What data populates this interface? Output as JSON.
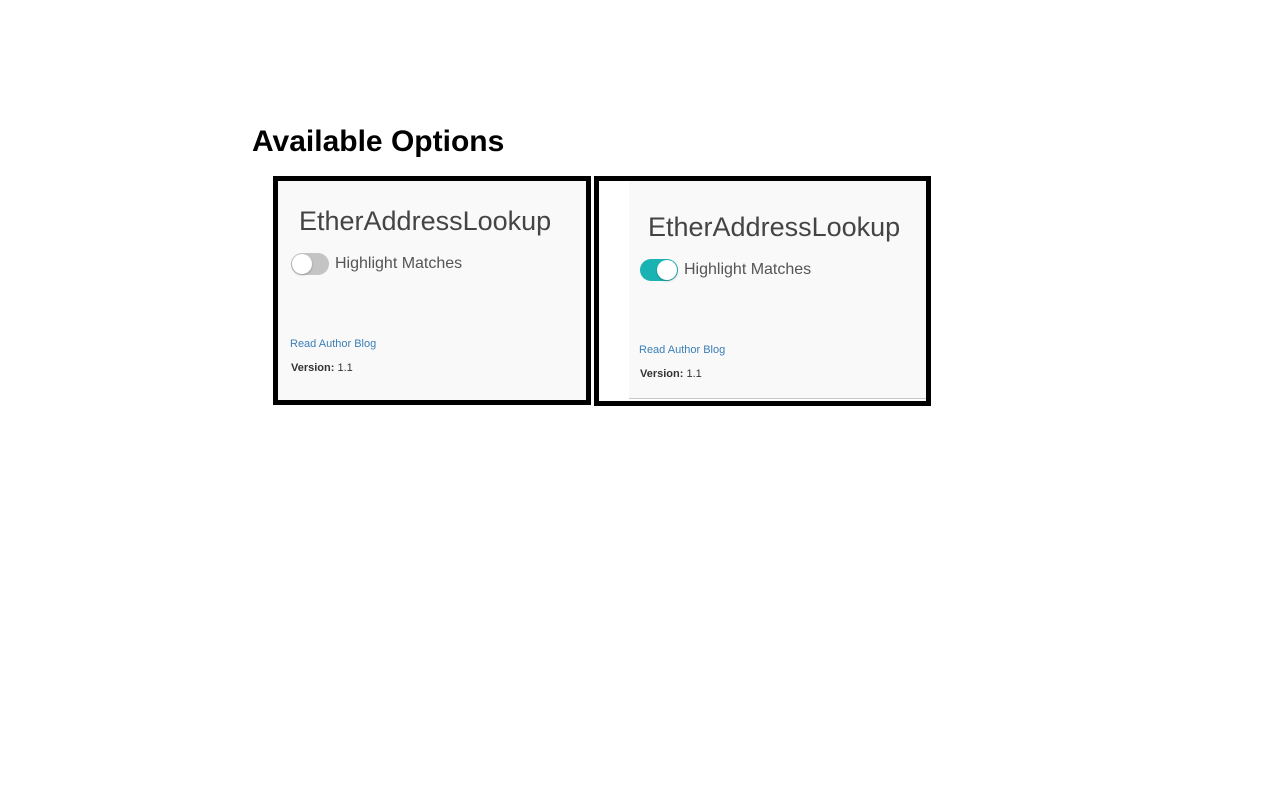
{
  "page": {
    "heading": "Available Options"
  },
  "panels": [
    {
      "title": "EtherAddressLookup",
      "toggle_label": "Highlight Matches",
      "toggle_state": "off",
      "link_label": "Read Author Blog",
      "version_key": "Version:",
      "version_value": "1.1"
    },
    {
      "title": "EtherAddressLookup",
      "toggle_label": "Highlight Matches",
      "toggle_state": "on",
      "link_label": "Read Author Blog",
      "version_key": "Version:",
      "version_value": "1.1"
    }
  ],
  "colors": {
    "toggle_on": "#1ab3b3",
    "toggle_off": "#c4c4c4",
    "link": "#3a7fb8",
    "frame_border": "#000000",
    "panel_background": "#f9f9f9"
  },
  "icons": {
    "toggle": "switch-icon"
  }
}
